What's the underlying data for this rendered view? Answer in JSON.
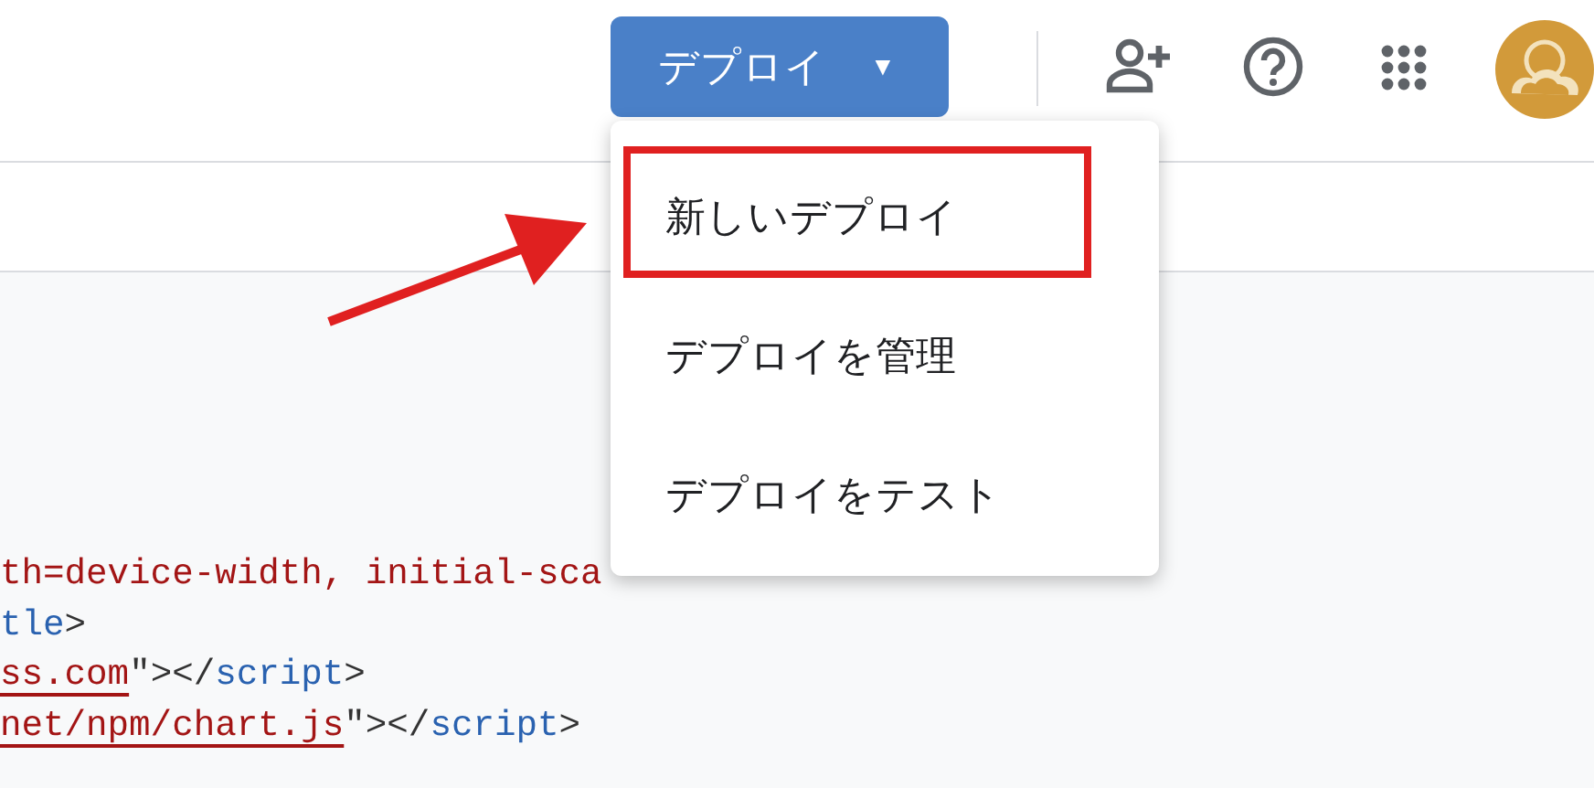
{
  "toolbar": {
    "deploy_button": {
      "label": "デプロイ",
      "caret": "▼",
      "expanded": true
    }
  },
  "deploy_menu": [
    {
      "label": "新しいデプロイ",
      "annotated": true
    },
    {
      "label": "デプロイを管理",
      "annotated": false
    },
    {
      "label": "デプロイをテスト",
      "annotated": false
    }
  ],
  "code_lines": [
    [
      {
        "kind": "value",
        "text": "th=device-width, initial-sca"
      }
    ],
    [
      {
        "kind": "tag",
        "text": "tle"
      },
      {
        "kind": "punct",
        "text": ">"
      }
    ],
    [
      {
        "kind": "link",
        "text": "ss.com"
      },
      {
        "kind": "punct",
        "text": "\"></"
      },
      {
        "kind": "tag",
        "text": "script"
      },
      {
        "kind": "punct",
        "text": ">"
      }
    ],
    [
      {
        "kind": "link",
        "text": "net/npm/chart.js"
      },
      {
        "kind": "punct",
        "text": "\"></"
      },
      {
        "kind": "tag",
        "text": "script"
      },
      {
        "kind": "punct",
        "text": ">"
      }
    ]
  ]
}
